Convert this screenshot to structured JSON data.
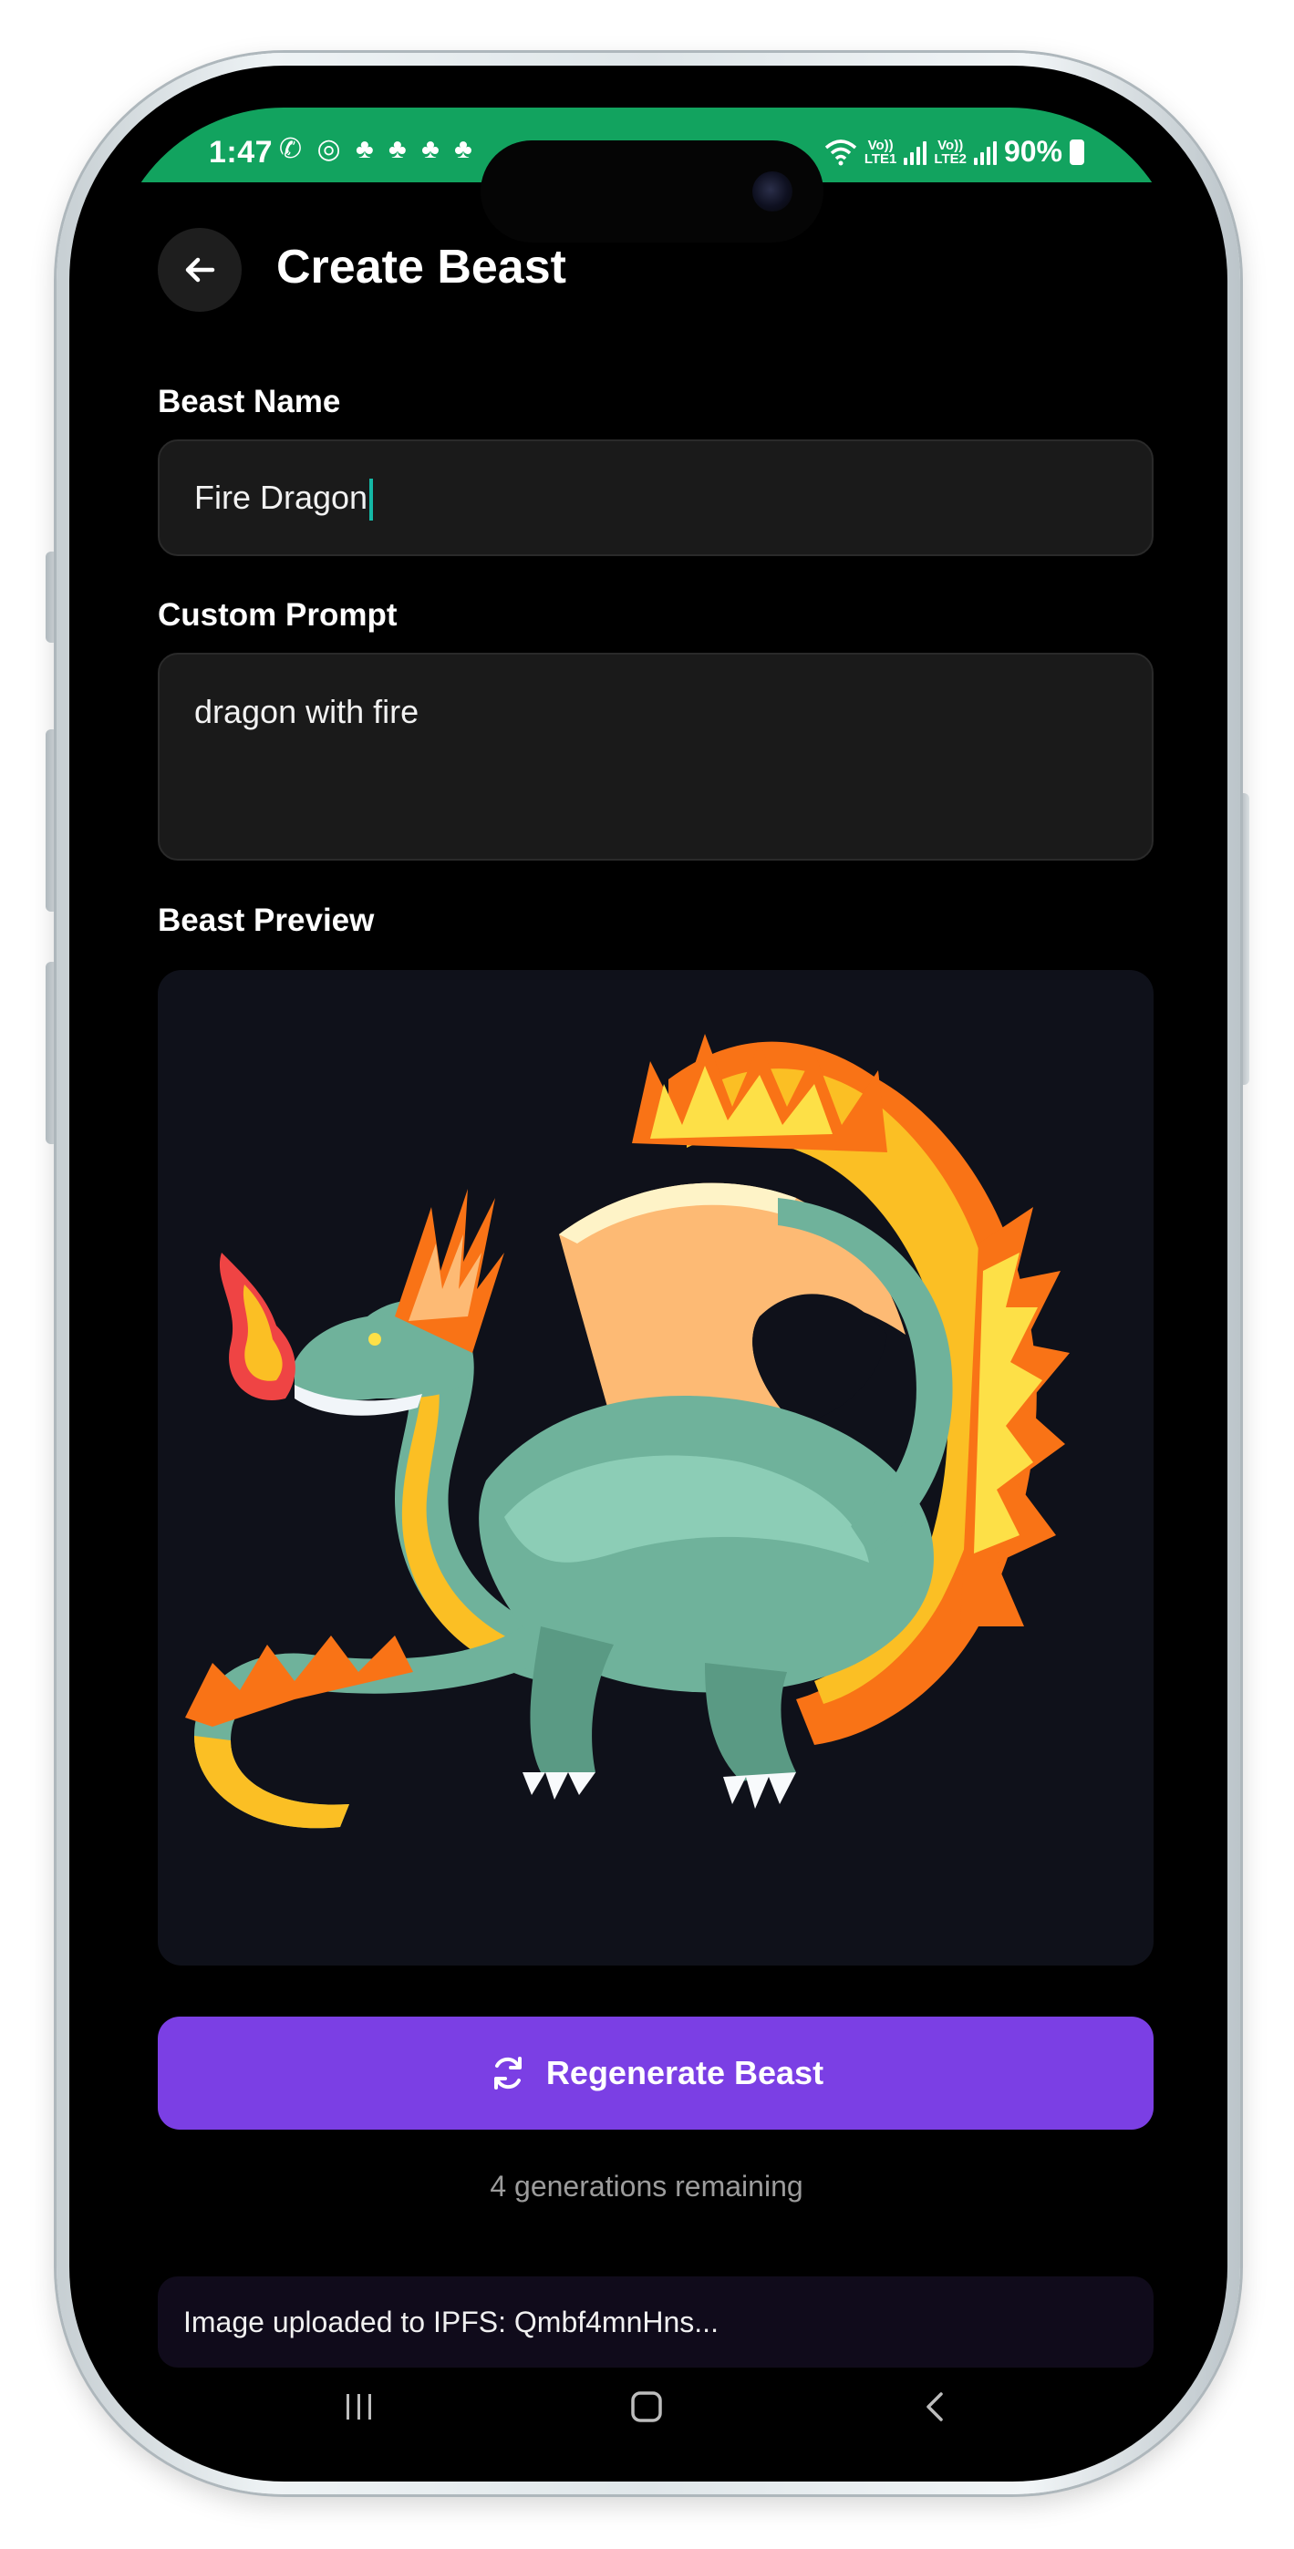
{
  "status_bar": {
    "time": "1:47",
    "notification_icons": [
      "phone-wifi-call-icon",
      "whatsapp-icon",
      "snapchat-icon",
      "snapchat-icon",
      "snapchat-icon",
      "snapchat-icon"
    ],
    "signal_1_label_top": "Vo))",
    "signal_1_label_bottom": "LTE1",
    "signal_2_label_top": "Vo))",
    "signal_2_label_bottom": "LTE2",
    "battery": "90%",
    "background_color": "#12a35f"
  },
  "header": {
    "title": "Create Beast"
  },
  "form": {
    "name_label": "Beast Name",
    "name_value": "Fire Dragon",
    "prompt_label": "Custom Prompt",
    "prompt_value": "dragon with fire",
    "preview_label": "Beast Preview"
  },
  "preview": {
    "subject": "pixel-art dragon breathing fire"
  },
  "actions": {
    "regenerate_label": "Regenerate Beast",
    "remaining_text": "4 generations remaining",
    "accent_color": "#7b3fe4"
  },
  "upload": {
    "message": "Image uploaded to IPFS: Qmbf4mnHns..."
  },
  "nav": {
    "items": [
      "recent-apps-icon",
      "home-icon",
      "back-nav-icon"
    ]
  }
}
